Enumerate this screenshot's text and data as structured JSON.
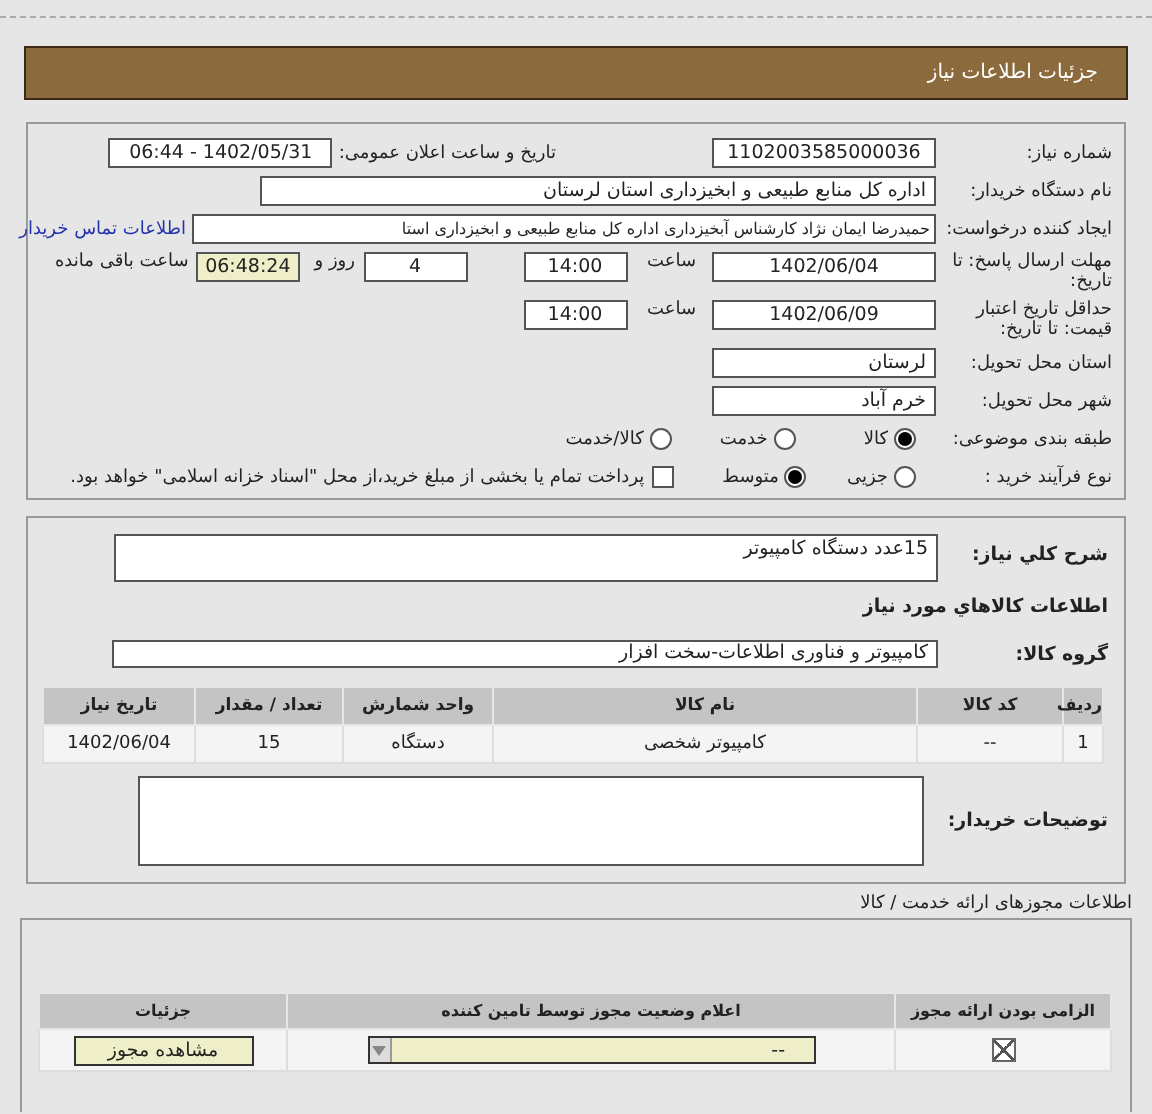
{
  "header": {
    "title": "جزئیات اطلاعات نیاز"
  },
  "need_info": {
    "need_number": {
      "label": "شماره نیاز:",
      "value": "1102003585000036"
    },
    "announce_date": {
      "label": "تاریخ و ساعت اعلان عمومی:",
      "value": "1402/05/31 - 06:44"
    },
    "buyer_org": {
      "label": "نام دستگاه خریدار:",
      "value": "اداره کل منابع طبیعی و ابخیزداری استان لرستان"
    },
    "requester": {
      "label": "ایجاد کننده درخواست:",
      "value": "حمیدرضا ایمان نژاد کارشناس آبخیزداری اداره کل منابع طبیعی و ابخیزداری استا",
      "link": "اطلاعات تماس خریدار"
    },
    "reply_deadline": {
      "label": "مهلت ارسال پاسخ: تا تاریخ:",
      "date": "1402/06/04",
      "time_label": "ساعت",
      "time": "14:00",
      "days": "4",
      "days_label": "روز و",
      "remaining": "06:48:24",
      "remaining_label": "ساعت باقی مانده"
    },
    "price_validity": {
      "label": "حداقل تاریخ اعتبار قیمت: تا تاریخ:",
      "date": "1402/06/09",
      "time_label": "ساعت",
      "time": "14:00"
    },
    "province": {
      "label": "استان محل تحویل:",
      "value": "لرستان"
    },
    "city": {
      "label": "شهر محل تحویل:",
      "value": "خرم آباد"
    },
    "category": {
      "label": "طبقه بندی موضوعی:",
      "options": [
        {
          "label": "کالا",
          "selected": true
        },
        {
          "label": "خدمت",
          "selected": false
        },
        {
          "label": "کالا/خدمت",
          "selected": false
        }
      ]
    },
    "purchase_process": {
      "label": "نوع فرآیند خرید :",
      "options": [
        {
          "label": "جزیی",
          "selected": false
        },
        {
          "label": "متوسط",
          "selected": true
        }
      ],
      "payment_note": {
        "checked": false,
        "text": "پرداخت تمام یا بخشی از مبلغ خرید،از محل \"اسناد خزانه اسلامی\" خواهد بود."
      }
    }
  },
  "goods": {
    "description": {
      "label": "شرح کلي نياز:",
      "value": "15عدد دستگاه کامپیوتر"
    },
    "section_title": "اطلاعات کالاهاي مورد نياز",
    "group": {
      "label": "گروه کالا:",
      "value": "کامپیوتر و فناوری اطلاعات-سخت افزار"
    },
    "table": {
      "columns": [
        "ردیف",
        "کد کالا",
        "نام کالا",
        "واحد شمارش",
        "تعداد / مقدار",
        "تاریخ نیاز"
      ],
      "rows": [
        [
          "1",
          "--",
          "کامپیوتر شخصی",
          "دستگاه",
          "15",
          "1402/06/04"
        ]
      ]
    },
    "buyer_notes": {
      "label": "توضیحات خریدار:"
    }
  },
  "permits": {
    "title": "اطلاعات مجوزهای ارائه خدمت / کالا",
    "columns": [
      "الزامی بودن ارائه مجوز",
      "اعلام وضعیت مجوز توسط تامین کننده",
      "جزئیات"
    ],
    "rows": [
      {
        "required": true,
        "status": "--",
        "action": "مشاهده مجوز"
      }
    ]
  }
}
